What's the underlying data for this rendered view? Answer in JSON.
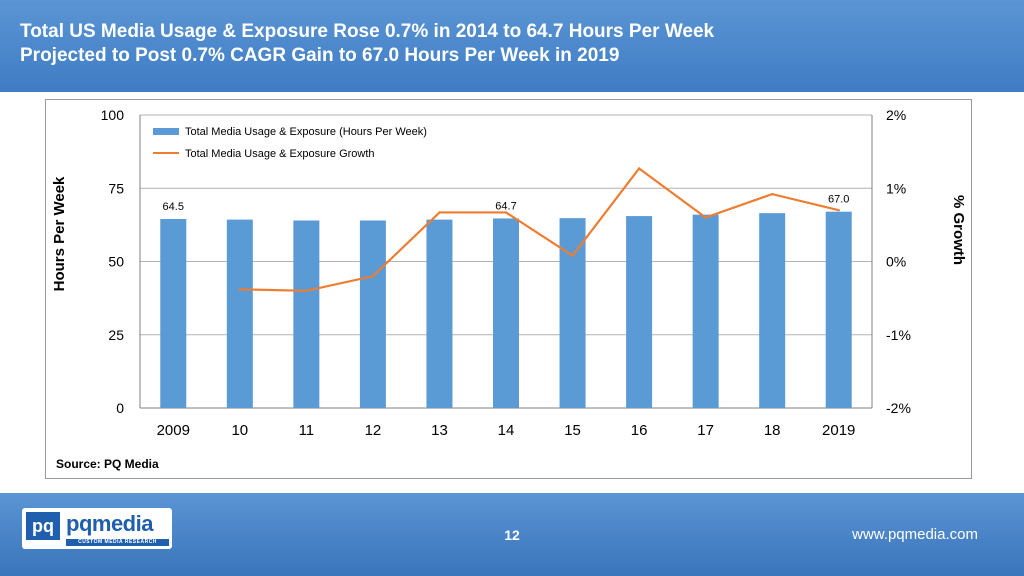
{
  "header": {
    "line1": "Total US Media Usage & Exposure Rose 0.7% in 2014 to 64.7 Hours Per Week",
    "line2": "Projected to Post 0.7% CAGR Gain to 67.0 Hours Per Week in 2019"
  },
  "source": "Source: PQ Media",
  "footer": {
    "logo_text": "pqmedia",
    "logo_sub": "CUSTOM MEDIA RESEARCH",
    "page_number": "12",
    "website": "www.pqmedia.com"
  },
  "colors": {
    "bar": "#5b9bd5",
    "line": "#ed7d31",
    "header_bg": "#4a87cc"
  },
  "chart_data": {
    "type": "bar",
    "categories": [
      "2009",
      "10",
      "11",
      "12",
      "13",
      "14",
      "15",
      "16",
      "17",
      "18",
      "2019"
    ],
    "series": [
      {
        "name": "Total Media Usage & Exposure (Hours Per Week)",
        "type": "bar",
        "axis": "left",
        "values": [
          64.5,
          64.3,
          64.0,
          64.0,
          64.3,
          64.7,
          64.8,
          65.5,
          66.0,
          66.5,
          67.0
        ]
      },
      {
        "name": "Total Media Usage & Exposure Growth",
        "type": "line",
        "axis": "right",
        "values_percent": [
          null,
          -0.38,
          -0.4,
          -0.2,
          0.67,
          0.67,
          0.08,
          1.27,
          0.6,
          0.92,
          0.7
        ]
      }
    ],
    "data_labels": [
      {
        "index": 0,
        "text": "64.5"
      },
      {
        "index": 5,
        "text": "64.7"
      },
      {
        "index": 10,
        "text": "67.0"
      }
    ],
    "ylabel": "Hours Per Week",
    "y2label": "% Growth",
    "ylim": [
      0,
      100
    ],
    "y_ticks": [
      "0",
      "25",
      "50",
      "75",
      "100"
    ],
    "y2lim": [
      -2,
      2
    ],
    "y2_ticks": [
      "-2%",
      "-1%",
      "0%",
      "1%",
      "2%"
    ],
    "grid": true,
    "legend_position": "top-left"
  }
}
